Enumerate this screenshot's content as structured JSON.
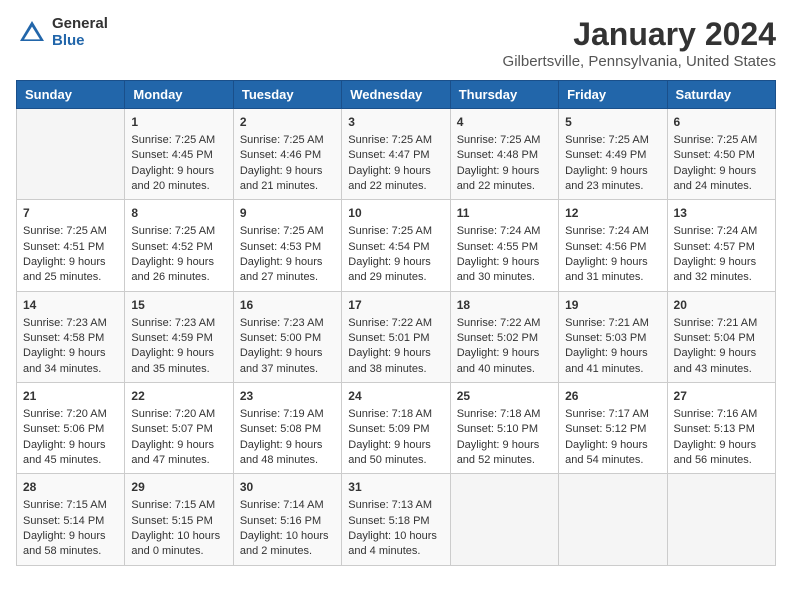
{
  "header": {
    "logo_general": "General",
    "logo_blue": "Blue",
    "title": "January 2024",
    "subtitle": "Gilbertsville, Pennsylvania, United States"
  },
  "days_of_week": [
    "Sunday",
    "Monday",
    "Tuesday",
    "Wednesday",
    "Thursday",
    "Friday",
    "Saturday"
  ],
  "weeks": [
    [
      {
        "day": "",
        "sunrise": "",
        "sunset": "",
        "daylight": ""
      },
      {
        "day": "1",
        "sunrise": "Sunrise: 7:25 AM",
        "sunset": "Sunset: 4:45 PM",
        "daylight": "Daylight: 9 hours and 20 minutes."
      },
      {
        "day": "2",
        "sunrise": "Sunrise: 7:25 AM",
        "sunset": "Sunset: 4:46 PM",
        "daylight": "Daylight: 9 hours and 21 minutes."
      },
      {
        "day": "3",
        "sunrise": "Sunrise: 7:25 AM",
        "sunset": "Sunset: 4:47 PM",
        "daylight": "Daylight: 9 hours and 22 minutes."
      },
      {
        "day": "4",
        "sunrise": "Sunrise: 7:25 AM",
        "sunset": "Sunset: 4:48 PM",
        "daylight": "Daylight: 9 hours and 22 minutes."
      },
      {
        "day": "5",
        "sunrise": "Sunrise: 7:25 AM",
        "sunset": "Sunset: 4:49 PM",
        "daylight": "Daylight: 9 hours and 23 minutes."
      },
      {
        "day": "6",
        "sunrise": "Sunrise: 7:25 AM",
        "sunset": "Sunset: 4:50 PM",
        "daylight": "Daylight: 9 hours and 24 minutes."
      }
    ],
    [
      {
        "day": "7",
        "sunrise": "Sunrise: 7:25 AM",
        "sunset": "Sunset: 4:51 PM",
        "daylight": "Daylight: 9 hours and 25 minutes."
      },
      {
        "day": "8",
        "sunrise": "Sunrise: 7:25 AM",
        "sunset": "Sunset: 4:52 PM",
        "daylight": "Daylight: 9 hours and 26 minutes."
      },
      {
        "day": "9",
        "sunrise": "Sunrise: 7:25 AM",
        "sunset": "Sunset: 4:53 PM",
        "daylight": "Daylight: 9 hours and 27 minutes."
      },
      {
        "day": "10",
        "sunrise": "Sunrise: 7:25 AM",
        "sunset": "Sunset: 4:54 PM",
        "daylight": "Daylight: 9 hours and 29 minutes."
      },
      {
        "day": "11",
        "sunrise": "Sunrise: 7:24 AM",
        "sunset": "Sunset: 4:55 PM",
        "daylight": "Daylight: 9 hours and 30 minutes."
      },
      {
        "day": "12",
        "sunrise": "Sunrise: 7:24 AM",
        "sunset": "Sunset: 4:56 PM",
        "daylight": "Daylight: 9 hours and 31 minutes."
      },
      {
        "day": "13",
        "sunrise": "Sunrise: 7:24 AM",
        "sunset": "Sunset: 4:57 PM",
        "daylight": "Daylight: 9 hours and 32 minutes."
      }
    ],
    [
      {
        "day": "14",
        "sunrise": "Sunrise: 7:23 AM",
        "sunset": "Sunset: 4:58 PM",
        "daylight": "Daylight: 9 hours and 34 minutes."
      },
      {
        "day": "15",
        "sunrise": "Sunrise: 7:23 AM",
        "sunset": "Sunset: 4:59 PM",
        "daylight": "Daylight: 9 hours and 35 minutes."
      },
      {
        "day": "16",
        "sunrise": "Sunrise: 7:23 AM",
        "sunset": "Sunset: 5:00 PM",
        "daylight": "Daylight: 9 hours and 37 minutes."
      },
      {
        "day": "17",
        "sunrise": "Sunrise: 7:22 AM",
        "sunset": "Sunset: 5:01 PM",
        "daylight": "Daylight: 9 hours and 38 minutes."
      },
      {
        "day": "18",
        "sunrise": "Sunrise: 7:22 AM",
        "sunset": "Sunset: 5:02 PM",
        "daylight": "Daylight: 9 hours and 40 minutes."
      },
      {
        "day": "19",
        "sunrise": "Sunrise: 7:21 AM",
        "sunset": "Sunset: 5:03 PM",
        "daylight": "Daylight: 9 hours and 41 minutes."
      },
      {
        "day": "20",
        "sunrise": "Sunrise: 7:21 AM",
        "sunset": "Sunset: 5:04 PM",
        "daylight": "Daylight: 9 hours and 43 minutes."
      }
    ],
    [
      {
        "day": "21",
        "sunrise": "Sunrise: 7:20 AM",
        "sunset": "Sunset: 5:06 PM",
        "daylight": "Daylight: 9 hours and 45 minutes."
      },
      {
        "day": "22",
        "sunrise": "Sunrise: 7:20 AM",
        "sunset": "Sunset: 5:07 PM",
        "daylight": "Daylight: 9 hours and 47 minutes."
      },
      {
        "day": "23",
        "sunrise": "Sunrise: 7:19 AM",
        "sunset": "Sunset: 5:08 PM",
        "daylight": "Daylight: 9 hours and 48 minutes."
      },
      {
        "day": "24",
        "sunrise": "Sunrise: 7:18 AM",
        "sunset": "Sunset: 5:09 PM",
        "daylight": "Daylight: 9 hours and 50 minutes."
      },
      {
        "day": "25",
        "sunrise": "Sunrise: 7:18 AM",
        "sunset": "Sunset: 5:10 PM",
        "daylight": "Daylight: 9 hours and 52 minutes."
      },
      {
        "day": "26",
        "sunrise": "Sunrise: 7:17 AM",
        "sunset": "Sunset: 5:12 PM",
        "daylight": "Daylight: 9 hours and 54 minutes."
      },
      {
        "day": "27",
        "sunrise": "Sunrise: 7:16 AM",
        "sunset": "Sunset: 5:13 PM",
        "daylight": "Daylight: 9 hours and 56 minutes."
      }
    ],
    [
      {
        "day": "28",
        "sunrise": "Sunrise: 7:15 AM",
        "sunset": "Sunset: 5:14 PM",
        "daylight": "Daylight: 9 hours and 58 minutes."
      },
      {
        "day": "29",
        "sunrise": "Sunrise: 7:15 AM",
        "sunset": "Sunset: 5:15 PM",
        "daylight": "Daylight: 10 hours and 0 minutes."
      },
      {
        "day": "30",
        "sunrise": "Sunrise: 7:14 AM",
        "sunset": "Sunset: 5:16 PM",
        "daylight": "Daylight: 10 hours and 2 minutes."
      },
      {
        "day": "31",
        "sunrise": "Sunrise: 7:13 AM",
        "sunset": "Sunset: 5:18 PM",
        "daylight": "Daylight: 10 hours and 4 minutes."
      },
      {
        "day": "",
        "sunrise": "",
        "sunset": "",
        "daylight": ""
      },
      {
        "day": "",
        "sunrise": "",
        "sunset": "",
        "daylight": ""
      },
      {
        "day": "",
        "sunrise": "",
        "sunset": "",
        "daylight": ""
      }
    ]
  ]
}
